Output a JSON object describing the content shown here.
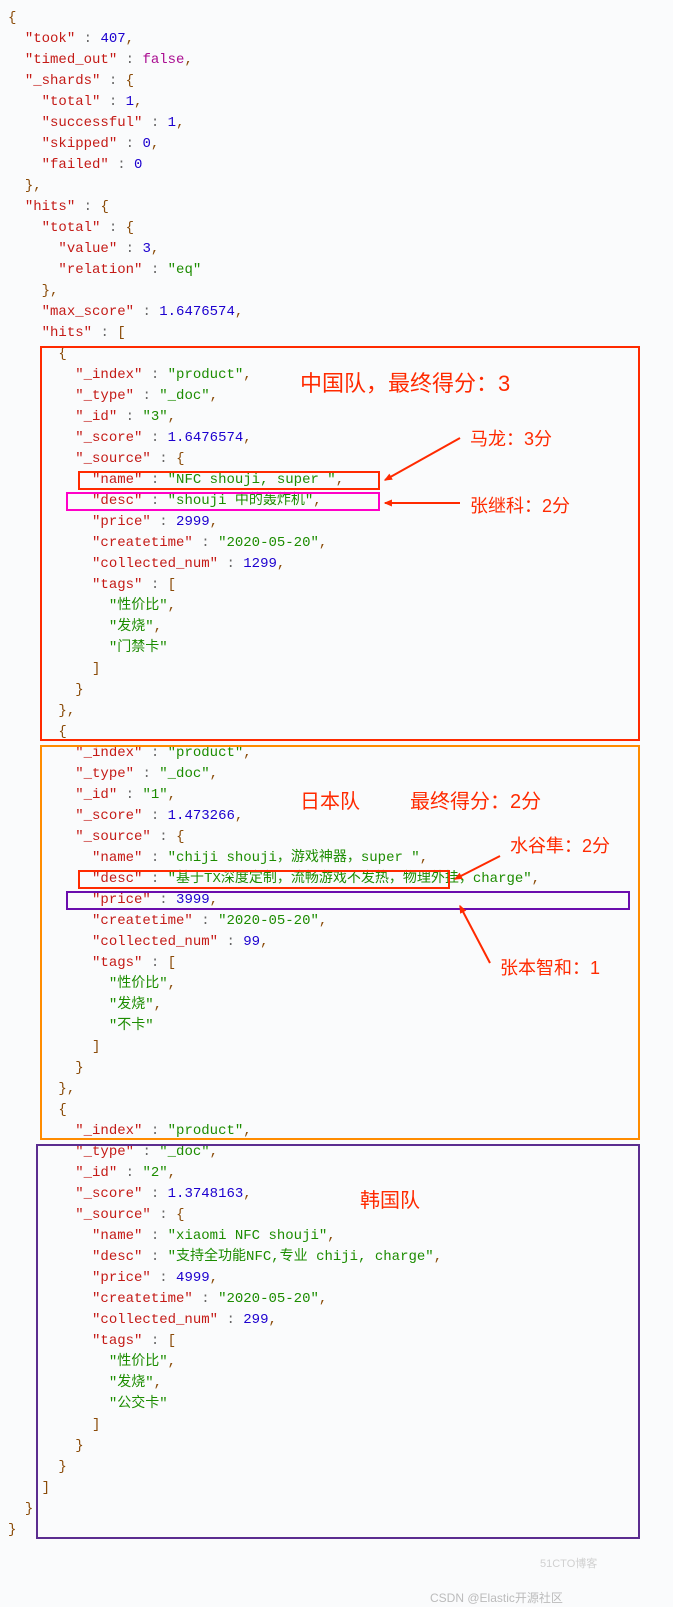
{
  "json": {
    "took": 407,
    "timed_out": false,
    "shards": {
      "total": 1,
      "successful": 1,
      "skipped": 0,
      "failed": 0
    },
    "hits": {
      "total": {
        "value": 3,
        "relation": "eq"
      },
      "max_score": 1.6476574,
      "hits_arr": [
        {
          "_index": "product",
          "_type": "_doc",
          "_id": "3",
          "_score": 1.6476574,
          "source": {
            "name": "NFC shouji, super ",
            "desc": "shouji 中的轰炸机",
            "price": 2999,
            "createtime": "2020-05-20",
            "collected_num": 1299,
            "tags": [
              "性价比",
              "发烧",
              "门禁卡"
            ]
          }
        },
        {
          "_index": "product",
          "_type": "_doc",
          "_id": "1",
          "_score": 1.473266,
          "source": {
            "name": "chiji shouji，游戏神器，super ",
            "desc": "基于TX深度定制，流畅游戏不发热，物理外挂，charge",
            "price": 3999,
            "createtime": "2020-05-20",
            "collected_num": 99,
            "tags": [
              "性价比",
              "发烧",
              "不卡"
            ]
          }
        },
        {
          "_index": "product",
          "_type": "_doc",
          "_id": "2",
          "_score": 1.3748163,
          "source": {
            "name": "xiaomi NFC shouji",
            "desc": "支持全功能NFC,专业 chiji, charge",
            "price": 4999,
            "createtime": "2020-05-20",
            "collected_num": 299,
            "tags": [
              "性价比",
              "发烧",
              "公交卡"
            ]
          }
        }
      ]
    }
  },
  "ann": {
    "box1_title": "中国队，最终得分：3",
    "box1_line1": "马龙：3分",
    "box1_line2": "张继科：2分",
    "box2_title1": "日本队",
    "box2_title2": "最终得分：2分",
    "box2_line1": "水谷隼：2分",
    "box2_line2": "张本智和：1",
    "box3_title": "韩国队"
  },
  "footer": {
    "wm1": "51CTO博客",
    "wm2": "CSDN @Elastic开源社区"
  }
}
